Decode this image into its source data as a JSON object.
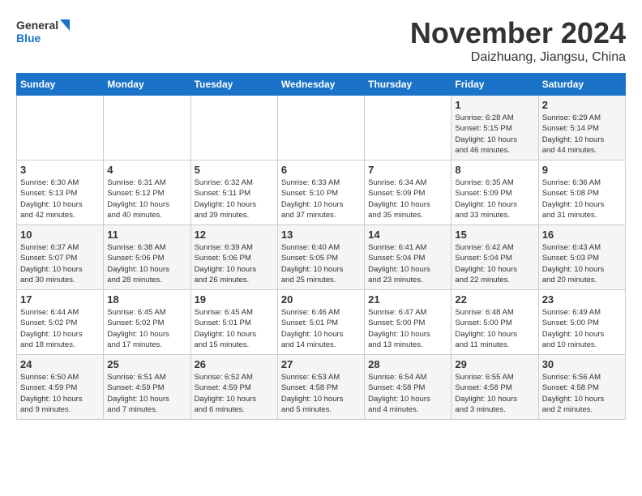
{
  "logo": {
    "line1": "General",
    "line2": "Blue"
  },
  "title": "November 2024",
  "location": "Daizhuang, Jiangsu, China",
  "weekdays": [
    "Sunday",
    "Monday",
    "Tuesday",
    "Wednesday",
    "Thursday",
    "Friday",
    "Saturday"
  ],
  "weeks": [
    [
      {
        "day": "",
        "info": ""
      },
      {
        "day": "",
        "info": ""
      },
      {
        "day": "",
        "info": ""
      },
      {
        "day": "",
        "info": ""
      },
      {
        "day": "",
        "info": ""
      },
      {
        "day": "1",
        "info": "Sunrise: 6:28 AM\nSunset: 5:15 PM\nDaylight: 10 hours\nand 46 minutes."
      },
      {
        "day": "2",
        "info": "Sunrise: 6:29 AM\nSunset: 5:14 PM\nDaylight: 10 hours\nand 44 minutes."
      }
    ],
    [
      {
        "day": "3",
        "info": "Sunrise: 6:30 AM\nSunset: 5:13 PM\nDaylight: 10 hours\nand 42 minutes."
      },
      {
        "day": "4",
        "info": "Sunrise: 6:31 AM\nSunset: 5:12 PM\nDaylight: 10 hours\nand 40 minutes."
      },
      {
        "day": "5",
        "info": "Sunrise: 6:32 AM\nSunset: 5:11 PM\nDaylight: 10 hours\nand 39 minutes."
      },
      {
        "day": "6",
        "info": "Sunrise: 6:33 AM\nSunset: 5:10 PM\nDaylight: 10 hours\nand 37 minutes."
      },
      {
        "day": "7",
        "info": "Sunrise: 6:34 AM\nSunset: 5:09 PM\nDaylight: 10 hours\nand 35 minutes."
      },
      {
        "day": "8",
        "info": "Sunrise: 6:35 AM\nSunset: 5:09 PM\nDaylight: 10 hours\nand 33 minutes."
      },
      {
        "day": "9",
        "info": "Sunrise: 6:36 AM\nSunset: 5:08 PM\nDaylight: 10 hours\nand 31 minutes."
      }
    ],
    [
      {
        "day": "10",
        "info": "Sunrise: 6:37 AM\nSunset: 5:07 PM\nDaylight: 10 hours\nand 30 minutes."
      },
      {
        "day": "11",
        "info": "Sunrise: 6:38 AM\nSunset: 5:06 PM\nDaylight: 10 hours\nand 28 minutes."
      },
      {
        "day": "12",
        "info": "Sunrise: 6:39 AM\nSunset: 5:06 PM\nDaylight: 10 hours\nand 26 minutes."
      },
      {
        "day": "13",
        "info": "Sunrise: 6:40 AM\nSunset: 5:05 PM\nDaylight: 10 hours\nand 25 minutes."
      },
      {
        "day": "14",
        "info": "Sunrise: 6:41 AM\nSunset: 5:04 PM\nDaylight: 10 hours\nand 23 minutes."
      },
      {
        "day": "15",
        "info": "Sunrise: 6:42 AM\nSunset: 5:04 PM\nDaylight: 10 hours\nand 22 minutes."
      },
      {
        "day": "16",
        "info": "Sunrise: 6:43 AM\nSunset: 5:03 PM\nDaylight: 10 hours\nand 20 minutes."
      }
    ],
    [
      {
        "day": "17",
        "info": "Sunrise: 6:44 AM\nSunset: 5:02 PM\nDaylight: 10 hours\nand 18 minutes."
      },
      {
        "day": "18",
        "info": "Sunrise: 6:45 AM\nSunset: 5:02 PM\nDaylight: 10 hours\nand 17 minutes."
      },
      {
        "day": "19",
        "info": "Sunrise: 6:45 AM\nSunset: 5:01 PM\nDaylight: 10 hours\nand 15 minutes."
      },
      {
        "day": "20",
        "info": "Sunrise: 6:46 AM\nSunset: 5:01 PM\nDaylight: 10 hours\nand 14 minutes."
      },
      {
        "day": "21",
        "info": "Sunrise: 6:47 AM\nSunset: 5:00 PM\nDaylight: 10 hours\nand 13 minutes."
      },
      {
        "day": "22",
        "info": "Sunrise: 6:48 AM\nSunset: 5:00 PM\nDaylight: 10 hours\nand 11 minutes."
      },
      {
        "day": "23",
        "info": "Sunrise: 6:49 AM\nSunset: 5:00 PM\nDaylight: 10 hours\nand 10 minutes."
      }
    ],
    [
      {
        "day": "24",
        "info": "Sunrise: 6:50 AM\nSunset: 4:59 PM\nDaylight: 10 hours\nand 9 minutes."
      },
      {
        "day": "25",
        "info": "Sunrise: 6:51 AM\nSunset: 4:59 PM\nDaylight: 10 hours\nand 7 minutes."
      },
      {
        "day": "26",
        "info": "Sunrise: 6:52 AM\nSunset: 4:59 PM\nDaylight: 10 hours\nand 6 minutes."
      },
      {
        "day": "27",
        "info": "Sunrise: 6:53 AM\nSunset: 4:58 PM\nDaylight: 10 hours\nand 5 minutes."
      },
      {
        "day": "28",
        "info": "Sunrise: 6:54 AM\nSunset: 4:58 PM\nDaylight: 10 hours\nand 4 minutes."
      },
      {
        "day": "29",
        "info": "Sunrise: 6:55 AM\nSunset: 4:58 PM\nDaylight: 10 hours\nand 3 minutes."
      },
      {
        "day": "30",
        "info": "Sunrise: 6:56 AM\nSunset: 4:58 PM\nDaylight: 10 hours\nand 2 minutes."
      }
    ]
  ]
}
